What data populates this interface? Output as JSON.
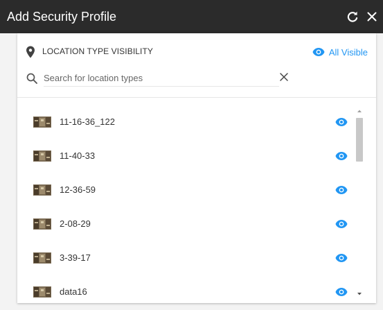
{
  "window": {
    "title": "Add Security Profile",
    "refresh_icon": "refresh-icon",
    "close_icon": "close-icon"
  },
  "section": {
    "label": "LOCATION TYPE VISIBILITY",
    "icon": "map-pin-icon",
    "all_visible_label": "All Visible"
  },
  "search": {
    "placeholder": "Search for location types",
    "value": ""
  },
  "items": [
    {
      "label": "11-16-36_122",
      "visible": true
    },
    {
      "label": "11-40-33",
      "visible": true
    },
    {
      "label": "12-36-59",
      "visible": true
    },
    {
      "label": "2-08-29",
      "visible": true
    },
    {
      "label": "3-39-17",
      "visible": true
    },
    {
      "label": "data16",
      "visible": true
    }
  ],
  "colors": {
    "accent": "#2196f3",
    "titlebar": "#2b2b2b"
  }
}
